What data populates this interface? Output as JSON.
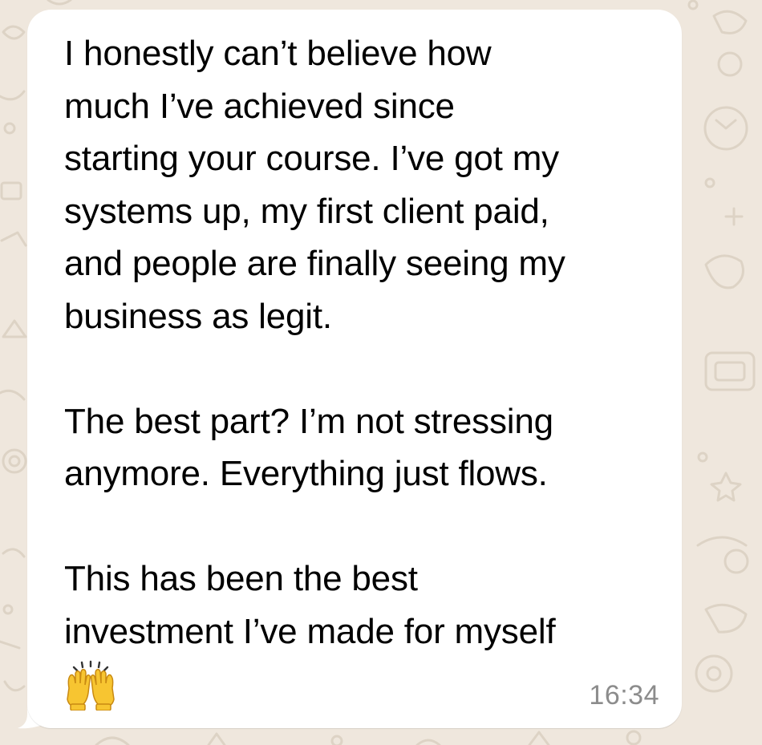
{
  "message": {
    "paragraphs": [
      "I honestly can’t believe how\nmuch I’ve achieved since\nstarting your course. I’ve got my\nsystems up, my first client paid,\nand people are finally seeing my\nbusiness as legit.",
      "The best part? I’m not stressing\nanymore. Everything just flows.",
      "This has been the best\ninvestment I’ve made for myself"
    ],
    "emoji_icon": "raising-hands-emoji",
    "timestamp": "16:34"
  },
  "colors": {
    "background": "#efe7dd",
    "bubble": "#ffffff",
    "text": "#000000",
    "timestamp": "#8c8c8c"
  }
}
